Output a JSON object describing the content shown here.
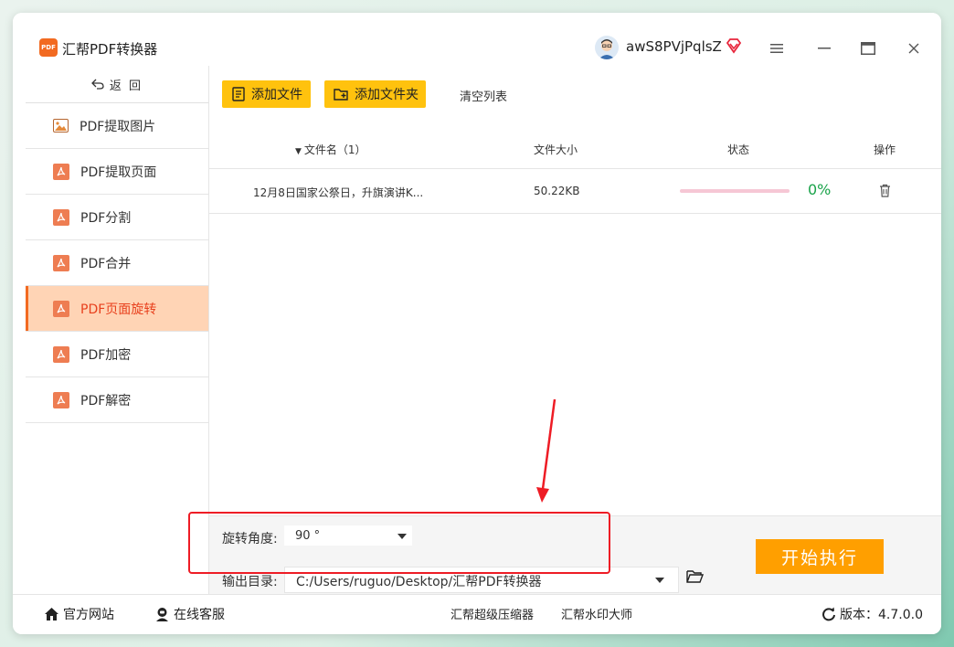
{
  "app": {
    "title": "汇帮PDF转换器",
    "logo_text": "PDF"
  },
  "user": {
    "name": "awS8PVjPqlsZ"
  },
  "window_controls": {
    "menu": "menu-icon",
    "minimize": "minimize-icon",
    "maximize": "maximize-icon",
    "close": "close-icon"
  },
  "sidebar": {
    "back_label": "返  回",
    "items": [
      {
        "label": "PDF提取图片",
        "icon": "image-icon",
        "active": false
      },
      {
        "label": "PDF提取页面",
        "icon": "pdf-icon",
        "active": false
      },
      {
        "label": "PDF分割",
        "icon": "pdf-icon",
        "active": false
      },
      {
        "label": "PDF合并",
        "icon": "pdf-icon",
        "active": false
      },
      {
        "label": "PDF页面旋转",
        "icon": "pdf-icon",
        "active": true
      },
      {
        "label": "PDF加密",
        "icon": "pdf-icon",
        "active": false
      },
      {
        "label": "PDF解密",
        "icon": "pdf-icon",
        "active": false
      }
    ]
  },
  "toolbar": {
    "add_file": "添加文件",
    "add_folder": "添加文件夹",
    "clear_list": "清空列表"
  },
  "table": {
    "headers": {
      "filename": "文件名（1）",
      "size": "文件大小",
      "status": "状态",
      "action": "操作"
    },
    "rows": [
      {
        "name": "12月8日国家公祭日，升旗演讲K...",
        "size": "50.22KB",
        "progress": 0,
        "progress_text": "0%"
      }
    ]
  },
  "options": {
    "angle_label": "旋转角度:",
    "angle_value": "90 °",
    "output_label": "输出目录:",
    "output_value": "C:/Users/ruguo/Desktop/汇帮PDF转换器",
    "start_label": "开始执行"
  },
  "statusbar": {
    "website": "官方网站",
    "support": "在线客服",
    "compressor": "汇帮超级压缩器",
    "watermark": "汇帮水印大师",
    "version": "版本：4.7.0.0"
  },
  "colors": {
    "accent": "#ffc20e",
    "start": "#ff9f00",
    "active_bg": "#ffd4b5",
    "active_text": "#e8401d",
    "progress_green": "#1aa34a",
    "annotation_red": "#ee1c25"
  }
}
